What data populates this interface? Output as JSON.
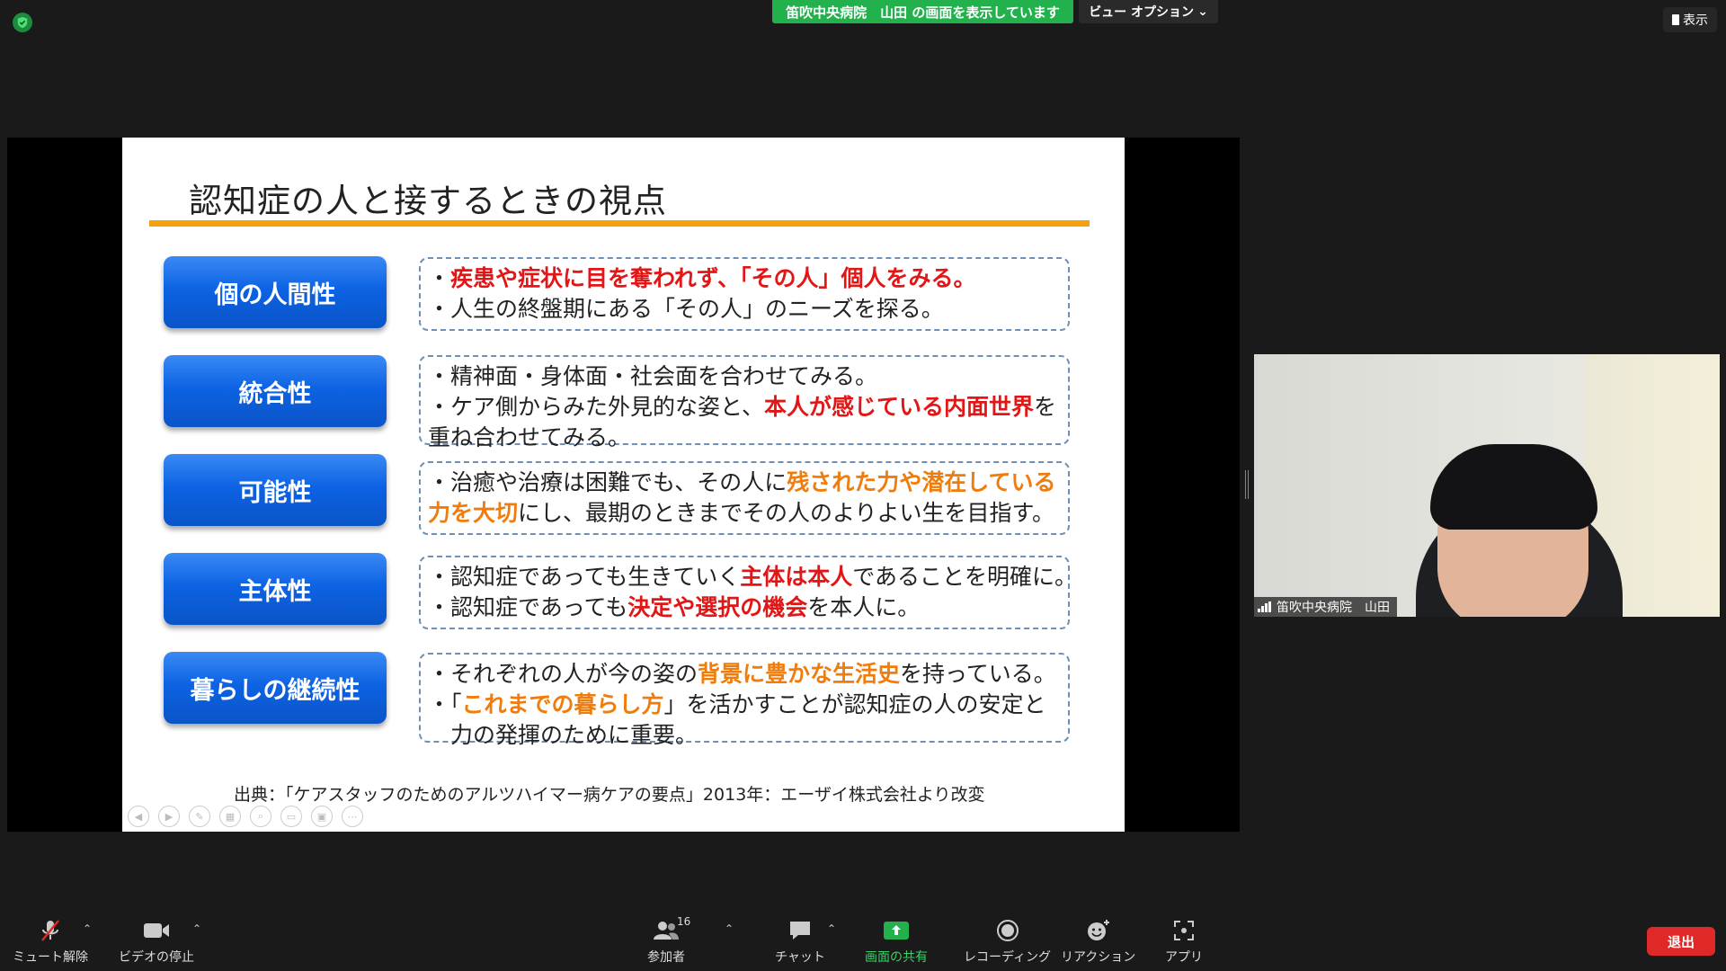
{
  "top": {
    "share_banner": "笛吹中央病院　山田 の画面を表示しています",
    "view_options": "ビュー オプション",
    "view_button": "表示"
  },
  "slide": {
    "title": "認知症の人と接するときの視点",
    "rows": [
      {
        "label": "個の人間性",
        "lines": [
          [
            {
              "t": "・",
              "s": ""
            },
            {
              "t": "疾患や症状に目を奪われず、「その人」個人をみる。",
              "s": "red"
            }
          ],
          [
            {
              "t": "・人生の終盤期にある「その人」のニーズを探る。",
              "s": ""
            }
          ]
        ]
      },
      {
        "label": "統合性",
        "lines": [
          [
            {
              "t": "・精神面・身体面・社会面を合わせてみる。",
              "s": ""
            }
          ],
          [
            {
              "t": "・ケア側からみた外見的な姿と、",
              "s": ""
            },
            {
              "t": "本人が感じている内面世界",
              "s": "red"
            },
            {
              "t": "を",
              "s": ""
            }
          ],
          [
            {
              "t": "重ね合わせてみる。",
              "s": ""
            }
          ]
        ]
      },
      {
        "label": "可能性",
        "lines": [
          [
            {
              "t": "・治癒や治療は困難でも、その人に",
              "s": ""
            },
            {
              "t": "残された力や潜在している",
              "s": "orange"
            }
          ],
          [
            {
              "t": "力を大切",
              "s": "orange"
            },
            {
              "t": "にし、最期のときまでその人のよりよい生を目指す。",
              "s": ""
            }
          ]
        ]
      },
      {
        "label": "主体性",
        "lines": [
          [
            {
              "t": "・認知症であっても生きていく",
              "s": ""
            },
            {
              "t": "主体は本人",
              "s": "red"
            },
            {
              "t": "であることを明確に。",
              "s": ""
            }
          ],
          [
            {
              "t": "・認知症であっても",
              "s": ""
            },
            {
              "t": "決定や選択の機会",
              "s": "red"
            },
            {
              "t": "を本人に。",
              "s": ""
            }
          ]
        ]
      },
      {
        "label": "暮らしの継続性",
        "lines": [
          [
            {
              "t": "・それぞれの人が今の姿の",
              "s": ""
            },
            {
              "t": "背景に豊かな生活史",
              "s": "orange"
            },
            {
              "t": "を持っている。",
              "s": ""
            }
          ],
          [
            {
              "t": "・「",
              "s": ""
            },
            {
              "t": "これまでの暮らし方",
              "s": "orange"
            },
            {
              "t": "」を活かすことが認知症の人の安定と",
              "s": ""
            }
          ],
          [
            {
              "t": "　力の発揮のために重要。",
              "s": ""
            }
          ]
        ]
      }
    ],
    "source": "出典：「ケアスタッフのためのアルツハイマー病ケアの要点」2013年：エーザイ株式会社より改変"
  },
  "video": {
    "participant_name": "笛吹中央病院　山田"
  },
  "toolbar": {
    "mute": "ミュート解除",
    "video": "ビデオの停止",
    "participants": "参加者",
    "participants_count": "16",
    "chat": "チャット",
    "share": "画面の共有",
    "record": "レコーディング",
    "reactions": "リアクション",
    "apps": "アプリ",
    "leave": "退出"
  },
  "colors": {
    "share_green": "#23b14d",
    "slide_blue": "#0d63e3",
    "accent_orange": "#f5a10e",
    "emphasis_red": "#e21616",
    "emphasis_orange": "#f07c0c",
    "leave_red": "#e02828"
  }
}
